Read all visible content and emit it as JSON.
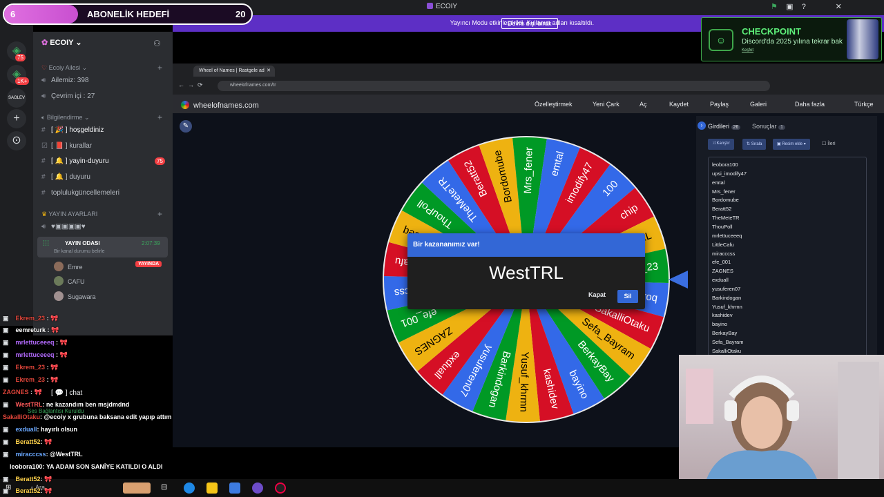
{
  "app": {
    "title": "ECOIY"
  },
  "sub_goal": {
    "count_left": "6",
    "label": "ABONELİK HEDEFİ",
    "count_right": "20",
    "progress": 0.3
  },
  "banner": {
    "text": "Yayıncı Modu etkinleştirildi. Kullanıcı adları kısaltıldı.",
    "button": "Devre dışı bırak"
  },
  "rail": {
    "badge1": "75",
    "badge2": "1K+",
    "server_label": "SAOLEV"
  },
  "sidebar": {
    "server_name": "ECOIY",
    "cat_family": "Ecoiy Ailesi",
    "ailemiz": "Ailemiz: 398",
    "cevrimici": "Çevrim içi : 27",
    "cat_info": "Bilgilendirme",
    "ch_hosgeldiniz": "hoşgeldiniz",
    "ch_kurallar": "kurallar",
    "ch_yayin_duyuru": "yayin-duyuru",
    "ch_yayin_duyuru_badge": "75",
    "ch_duyuru": "duyuru",
    "ch_topluluk": "toplulukgüncellemeleri",
    "cat_yayin": "YAYIN AYARLARI",
    "voice_room": "YAYIN ODASI",
    "voice_time": "2:07:39",
    "voice_status": "Bir kanal durumu belirle",
    "users": [
      "Emre",
      "CAFU",
      "Sugawara"
    ],
    "live_badge": "YAYINDA",
    "ch_chat": "chat",
    "voice_connected": "Ses Bağlantısı Kuruldu"
  },
  "chat": [
    {
      "user": "Ekrem_23",
      "text": "",
      "color": "#e0453a"
    },
    {
      "user": "eemreturk",
      "text": "",
      "color": "#ffffff"
    },
    {
      "user": "mrlettuceeeq",
      "text": "",
      "color": "#b46bff"
    },
    {
      "user": "mrlettuceeeq",
      "text": "",
      "color": "#b46bff"
    },
    {
      "user": "Ekrem_23",
      "text": "",
      "color": "#e0453a"
    },
    {
      "user": "Ekrem_23",
      "text": "",
      "color": "#e0453a"
    },
    {
      "user": "ZAGNES",
      "text": "",
      "color": "#e0453a"
    },
    {
      "user": "WestTRL",
      "text": ": ne kazandım ben msjdmdnd",
      "color": "#ff5a5a"
    },
    {
      "user": "SakalliOtaku",
      "text": ": @ecoiy x grubuna baksana edit yapıp attım",
      "color": "#e0453a"
    },
    {
      "user": "exduall",
      "text": ": hayırlı olsun",
      "color": "#6aa8ff"
    },
    {
      "user": "Beratt52",
      "text": ":",
      "color": "#ffd24a"
    },
    {
      "user": "miracccss",
      "text": ": @WestTRL",
      "color": "#6aa8ff"
    },
    {
      "user": "leobora100",
      "text": ": YA ADAM SON SANİYE KATILDI O ALDI",
      "color": "#ffffff"
    },
    {
      "user": "Beratt52",
      "text": ":",
      "color": "#ffd24a"
    },
    {
      "user": "Beratt52",
      "text": ":",
      "color": "#ffd24a"
    }
  ],
  "browser": {
    "tab_title": "Wheel of Names | Rastgele ad",
    "url": "wheelofnames.com/tr",
    "site_name": "wheelofnames.com",
    "nav": [
      "Özelleştirmek",
      "Yeni Çark",
      "Aç",
      "Kaydet",
      "Paylaş",
      "Galeri",
      "Daha fazla",
      "Türkçe"
    ]
  },
  "wheel": {
    "segments": [
      "100",
      "chip",
      "WestTRL",
      "Ekrem_23",
      "swolroq",
      "SakalliOtaku",
      "Sefa_Bayram",
      "BerkayBay",
      "bayino",
      "kashidev",
      "Yusuf_khrmn",
      "Barkindogan",
      "yusuferen07",
      "exduall",
      "ZAGNES",
      "efe_001",
      "miracccss",
      "LittleCafu",
      "mrlettuceeeq",
      "ThouPoll",
      "TheMeteTR",
      "Beratt52",
      "Bordomube",
      "Mrs_fener",
      "emtal",
      "imodify47"
    ],
    "colors": [
      "#3369e8",
      "#d50f25",
      "#eeb211",
      "#009925"
    ]
  },
  "dialog": {
    "title": "Bir kazananımız var!",
    "winner": "WestTRL",
    "close": "Kapat",
    "remove": "Sil"
  },
  "panel": {
    "tab_entries": "Girdileri",
    "entries_count": "26",
    "tab_results": "Sonuçlar",
    "results_count": "1",
    "btn_shuffle": "Karıştır",
    "btn_sort": "Sırala",
    "btn_add_image": "Resim ekle",
    "advanced": "İleri",
    "entries": [
      "leobora100",
      "upsi_imodify47",
      "emtal",
      "Mrs_fener",
      "Bordomube",
      "Beratt52",
      "TheMeteTR",
      "ThouPoll",
      "mrlettuceeeq",
      "LittleCafu",
      "miracccss",
      "efe_001",
      "ZAGNES",
      "exduall",
      "yusuferen07",
      "Barkindogan",
      "Yusuf_khrmn",
      "kashidev",
      "bayino",
      "BerkayBay",
      "Sefa_Bayram",
      "SakalliOtaku"
    ]
  },
  "checkpoint": {
    "title": "CHECKPOINT",
    "subtitle": "Discord'da 2025 yılına tekrar bak",
    "link": "Keşfet"
  },
  "taskbar": {
    "search": "Ara"
  }
}
